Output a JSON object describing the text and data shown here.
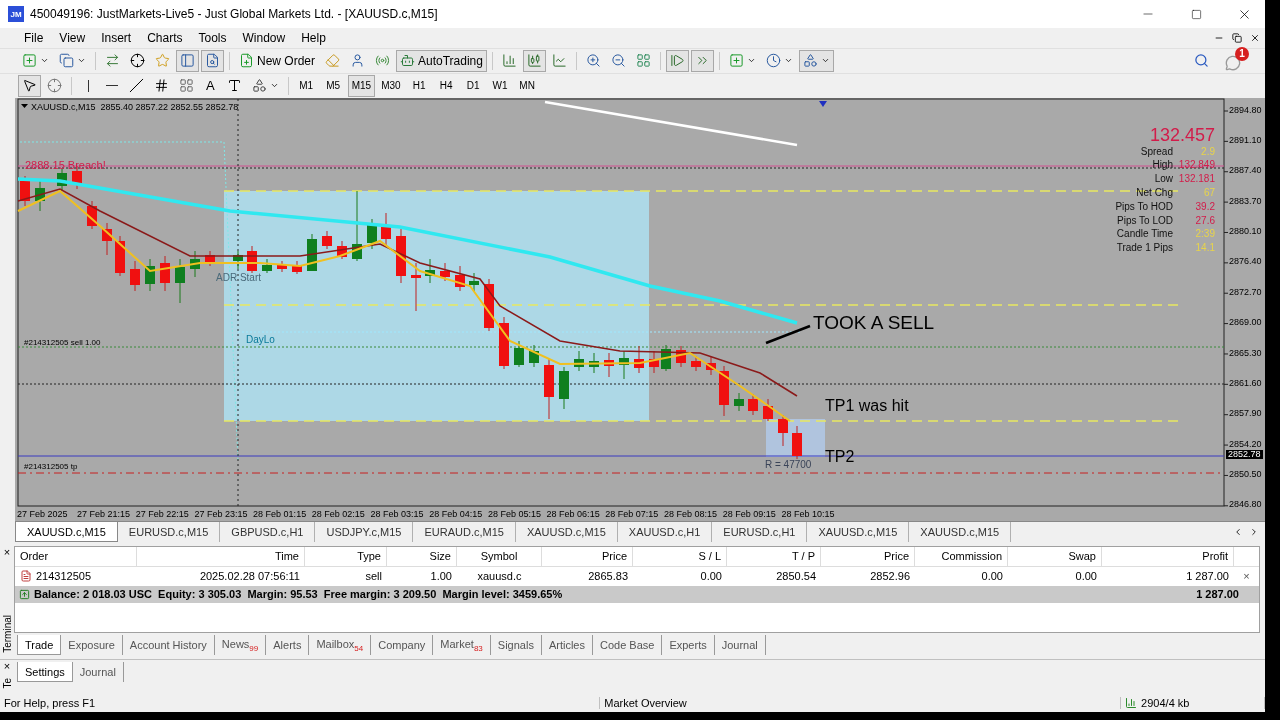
{
  "window": {
    "logo": "JM",
    "title": "450049196: JustMarkets-Live5 - Just Global Markets Ltd. - [XAUUSD.c,M15]"
  },
  "menu": [
    "File",
    "View",
    "Insert",
    "Charts",
    "Tools",
    "Window",
    "Help"
  ],
  "toolbar": {
    "new_order": "New Order",
    "auto_trading": "AutoTrading",
    "notification_count": "1"
  },
  "drawing_toolbar": {
    "text_tool": "A",
    "timeframes": [
      {
        "label": "M1",
        "selected": false
      },
      {
        "label": "M5",
        "selected": false
      },
      {
        "label": "M15",
        "selected": true
      },
      {
        "label": "M30",
        "selected": false
      },
      {
        "label": "H1",
        "selected": false
      },
      {
        "label": "H4",
        "selected": false
      },
      {
        "label": "D1",
        "selected": false
      },
      {
        "label": "W1",
        "selected": false
      },
      {
        "label": "MN",
        "selected": false
      }
    ]
  },
  "chart": {
    "header": "XAUUSD.c,M15  2855.40 2857.22 2852.55 2852.78",
    "breach_label": "2888.15 Breach!",
    "adr_start": "ADR Start",
    "day_lo": "DayLo",
    "order_label": "#214312505 sell 1.00",
    "tp_label": "#214312505 tp",
    "note_sell": "TOOK A SELL",
    "note_tp1": "TP1 was hit",
    "note_tp2": "TP2",
    "range_label": "R = 47700",
    "info_panel": {
      "price": "132.457",
      "rows": [
        {
          "label": "Spread",
          "value": "2.9",
          "color": "#e8d44a"
        },
        {
          "label": "High",
          "value": "132.849",
          "color": "#d21c4a"
        },
        {
          "label": "Low",
          "value": "132.181",
          "color": "#d21c4a"
        },
        {
          "label": "Net Chg",
          "value": "67",
          "color": "#e8d44a"
        },
        {
          "label": "Pips To HOD",
          "value": "39.2",
          "color": "#d21c4a"
        },
        {
          "label": "Pips To LOD",
          "value": "27.6",
          "color": "#d21c4a"
        },
        {
          "label": "Candle Time",
          "value": "2:39",
          "color": "#e8d44a"
        },
        {
          "label": "Trade 1 Pips",
          "value": "14.1",
          "color": "#e8d44a"
        }
      ]
    },
    "price_axis": [
      "2894.80",
      "2891.10",
      "2887.40",
      "2883.70",
      "2880.10",
      "2876.40",
      "2872.70",
      "2869.00",
      "2865.30",
      "2861.60",
      "2857.90",
      "2854.20",
      "2850.50",
      "2846.80"
    ],
    "current_price": "2852.78",
    "time_axis": [
      "27 Feb 2025",
      "27 Feb 21:15",
      "27 Feb 22:15",
      "27 Feb 23:15",
      "28 Feb 01:15",
      "28 Feb 02:15",
      "28 Feb 03:15",
      "28 Feb 04:15",
      "28 Feb 05:15",
      "28 Feb 06:15",
      "28 Feb 07:15",
      "28 Feb 08:15",
      "28 Feb 09:15",
      "28 Feb 10:15"
    ]
  },
  "chart_tabs": [
    {
      "label": "XAUUSD.c,M15",
      "selected": true
    },
    {
      "label": "EURUSD.c,M15",
      "selected": false
    },
    {
      "label": "GBPUSD.c,H1",
      "selected": false
    },
    {
      "label": "USDJPY.c,M15",
      "selected": false
    },
    {
      "label": "EURAUD.c,M15",
      "selected": false
    },
    {
      "label": "XAUUSD.c,M15",
      "selected": false
    },
    {
      "label": "XAUUSD.c,H1",
      "selected": false
    },
    {
      "label": "EURUSD.c,H1",
      "selected": false
    },
    {
      "label": "XAUUSD.c,M15",
      "selected": false
    },
    {
      "label": "XAUUSD.c,M15",
      "selected": false
    }
  ],
  "terminal": {
    "side_label": "Terminal",
    "close": "×",
    "columns": [
      "Order",
      "Time",
      "Type",
      "Size",
      "Symbol",
      "Price",
      "S / L",
      "T / P",
      "Price",
      "Commission",
      "Swap",
      "Profit"
    ],
    "rows": [
      {
        "cells": [
          "214312505",
          "2025.02.28 07:56:11",
          "sell",
          "1.00",
          "xauusd.c",
          "2865.83",
          "0.00",
          "2850.54",
          "2852.96",
          "0.00",
          "0.00",
          "1 287.00"
        ],
        "close": "×"
      }
    ],
    "summary": {
      "text": "Balance: 2 018.03 USC  Equity: 3 305.03  Margin: 95.53  Free margin: 3 209.50  Margin level: 3459.65%",
      "profit": "1 287.00"
    },
    "tabs": [
      {
        "label": "Trade",
        "selected": true
      },
      {
        "label": "Exposure",
        "selected": false
      },
      {
        "label": "Account History",
        "selected": false
      },
      {
        "label": "News",
        "badge": "99",
        "selected": false
      },
      {
        "label": "Alerts",
        "selected": false
      },
      {
        "label": "Mailbox",
        "badge": "54",
        "selected": false
      },
      {
        "label": "Company",
        "selected": false
      },
      {
        "label": "Market",
        "badge": "83",
        "selected": false
      },
      {
        "label": "Signals",
        "selected": false
      },
      {
        "label": "Articles",
        "selected": false
      },
      {
        "label": "Code Base",
        "selected": false
      },
      {
        "label": "Experts",
        "selected": false
      },
      {
        "label": "Journal",
        "selected": false
      }
    ]
  },
  "tester": {
    "side_label": "Te",
    "close": "×",
    "tabs": [
      {
        "label": "Settings",
        "selected": true
      },
      {
        "label": "Journal",
        "selected": false
      }
    ]
  },
  "status_bar": {
    "help": "For Help, press F1",
    "market": "Market Overview",
    "traffic": "2904/4 kb"
  }
}
